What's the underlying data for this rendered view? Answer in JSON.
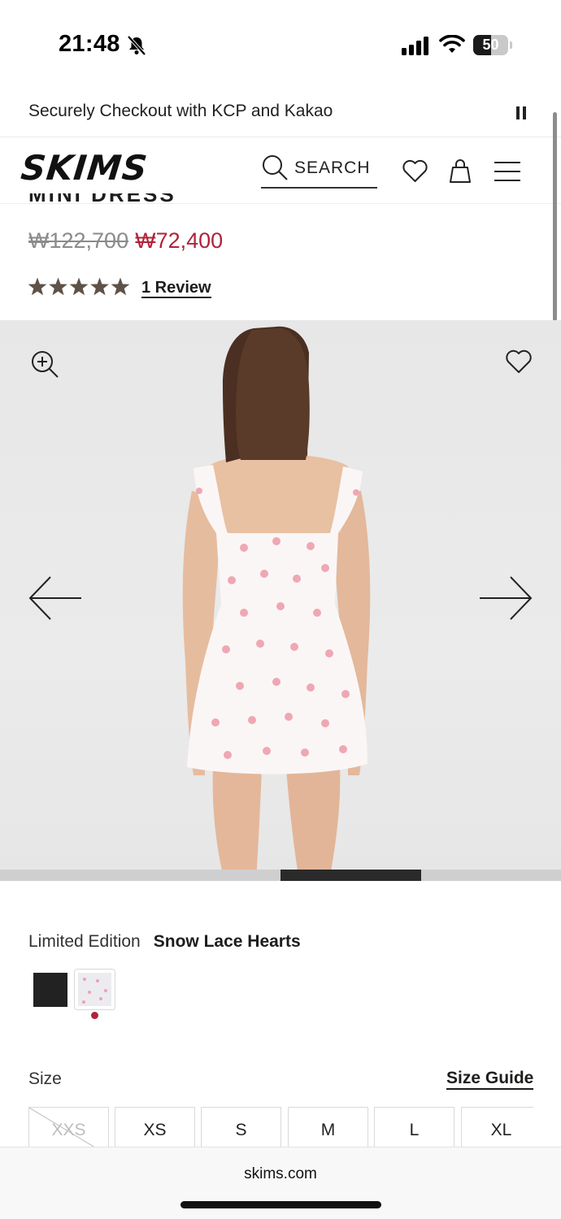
{
  "status_bar": {
    "time": "21:48",
    "battery_level": "50",
    "battery_fraction": 0.5,
    "icons": [
      "bell-slash-icon",
      "signal-icon",
      "wifi-icon",
      "battery-icon"
    ]
  },
  "announcement": {
    "text": "Securely Checkout with KCP and Kakao",
    "pause_icon": "pause-icon"
  },
  "header": {
    "logo": "SKIMS",
    "search_label": "SEARCH",
    "icons": [
      "search-icon",
      "heart-icon",
      "bag-icon",
      "menu-icon"
    ]
  },
  "product": {
    "name_partial": "MINI DRESS",
    "price_original": "₩122,700",
    "price_sale": "₩72,400",
    "rating": 5,
    "rating_max": 5,
    "review_link": "1 Review"
  },
  "gallery": {
    "progress_start": 0.5,
    "progress_end": 0.75,
    "icons": [
      "zoom-in-icon",
      "heart-icon",
      "arrow-left-icon",
      "arrow-right-icon"
    ]
  },
  "variant": {
    "color_label": "Limited Edition",
    "color_value": "Snow Lace Hearts",
    "swatches": [
      "black",
      "snow-lace-hearts"
    ],
    "selected_swatch": "snow-lace-hearts"
  },
  "size": {
    "label": "Size",
    "guide_link": "Size Guide",
    "options": [
      {
        "label": "XXS",
        "available": false
      },
      {
        "label": "XS",
        "available": true
      },
      {
        "label": "S",
        "available": true
      },
      {
        "label": "M",
        "available": true
      },
      {
        "label": "L",
        "available": true
      },
      {
        "label": "XL",
        "available": true
      }
    ]
  },
  "browser": {
    "url": "skims.com"
  },
  "colors": {
    "sale_red": "#b0233a",
    "text_dark": "#1d1d1b",
    "gallery_bg": "#e9e9e9"
  }
}
